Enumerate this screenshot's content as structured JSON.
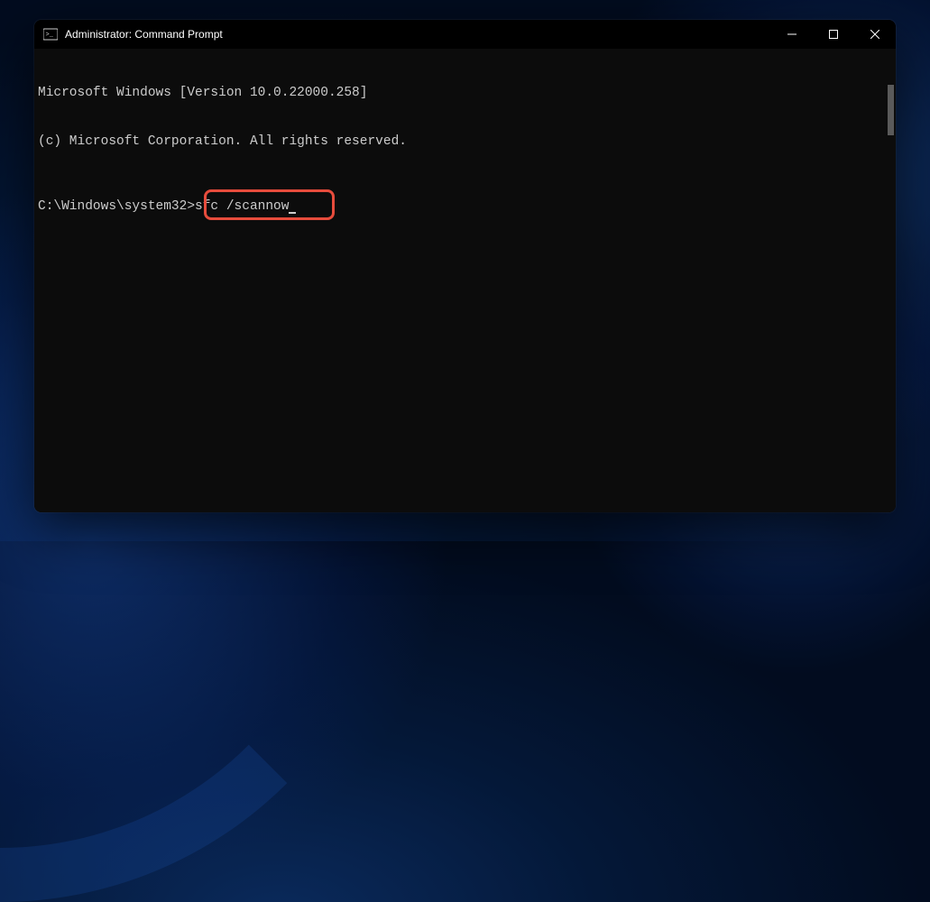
{
  "window": {
    "title": "Administrator: Command Prompt"
  },
  "terminal": {
    "line1": "Microsoft Windows [Version 10.0.22000.258]",
    "line2": "(c) Microsoft Corporation. All rights reserved.",
    "prompt": "C:\\Windows\\system32>",
    "command": "sfc /scannow"
  },
  "colors": {
    "highlight_border": "#e74c3c",
    "terminal_bg": "#0c0c0c",
    "terminal_fg": "#cccccc"
  }
}
